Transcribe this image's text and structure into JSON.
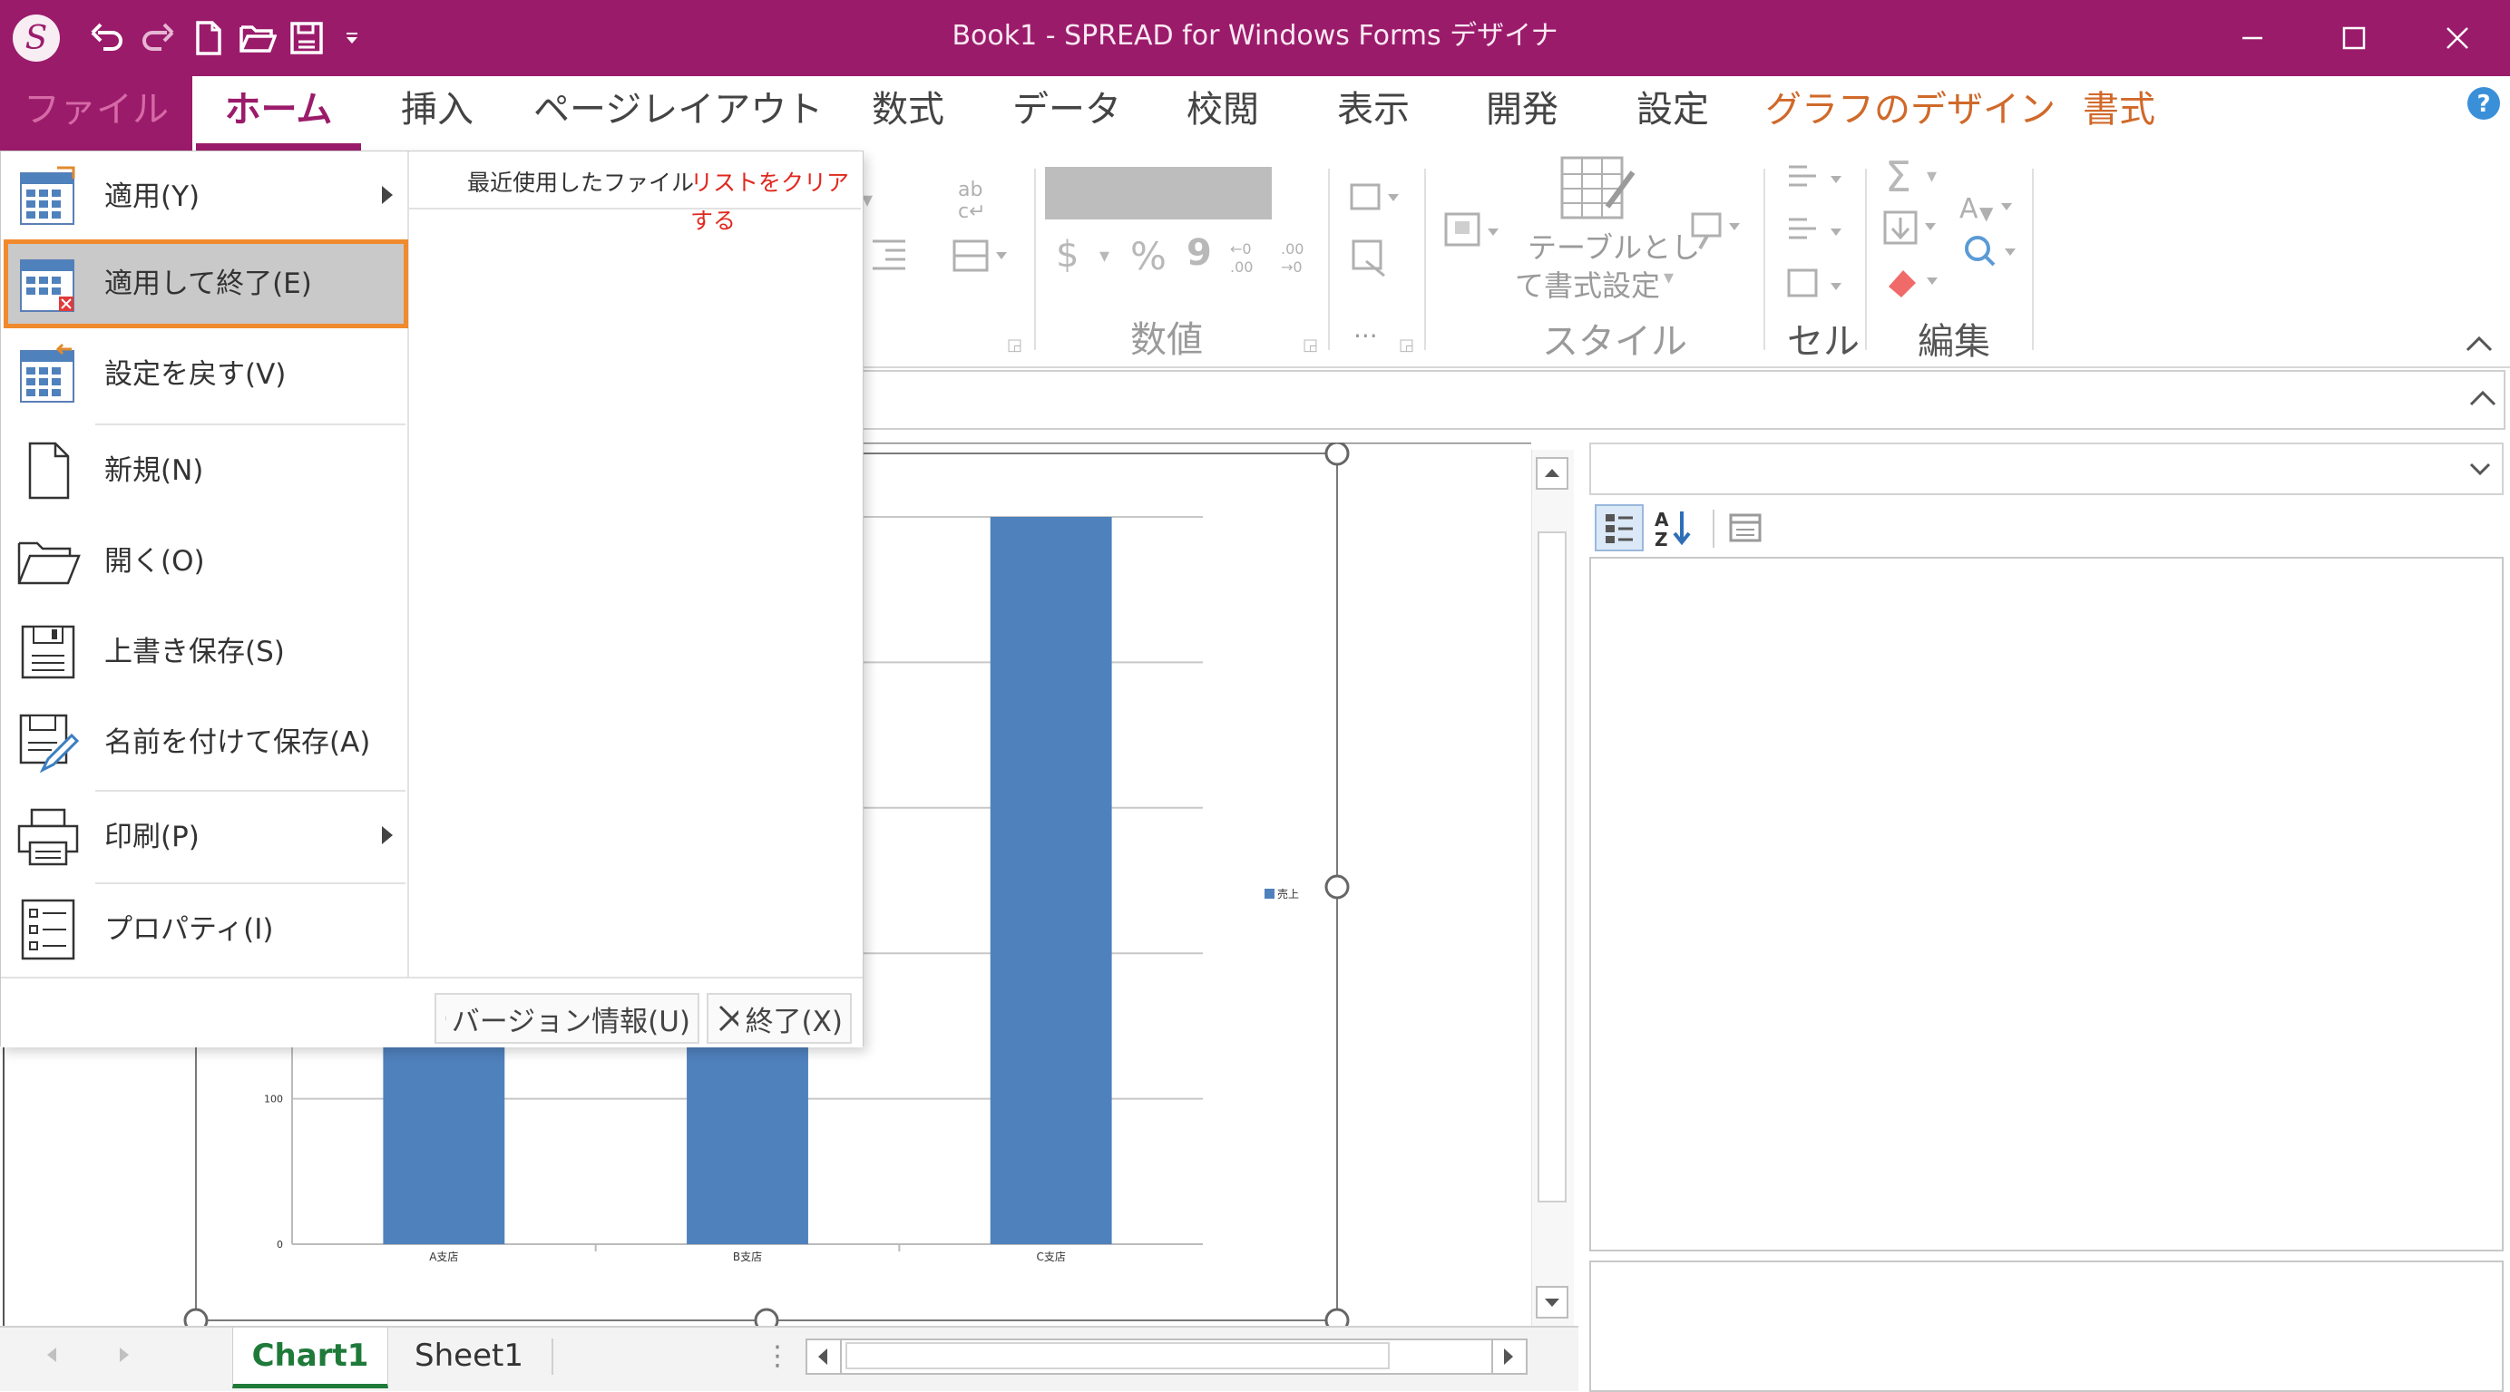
{
  "window": {
    "title": "Book1 - SPREAD for Windows Forms デザイナ",
    "accent_color": "#9b1b6b"
  },
  "quick_access": [
    "app-logo-icon",
    "undo-icon",
    "redo-icon",
    "new-file-icon",
    "open-folder-icon",
    "save-icon",
    "customize-dropdown-icon"
  ],
  "ribbon": {
    "tabs": [
      {
        "label": "ファイル",
        "id": "file"
      },
      {
        "label": "ホーム",
        "id": "home"
      },
      {
        "label": "挿入",
        "id": "insert"
      },
      {
        "label": "ページレイアウト",
        "id": "page-layout"
      },
      {
        "label": "数式",
        "id": "formulas"
      },
      {
        "label": "データ",
        "id": "data"
      },
      {
        "label": "校閲",
        "id": "review"
      },
      {
        "label": "表示",
        "id": "view"
      },
      {
        "label": "開発",
        "id": "developer"
      },
      {
        "label": "設定",
        "id": "settings"
      },
      {
        "label": "グラフのデザイン",
        "id": "chart-design"
      },
      {
        "label": "書式",
        "id": "format"
      }
    ],
    "groups": {
      "number": "数値",
      "style": "スタイル",
      "cells": "セル",
      "editing": "編集",
      "number_currency": "$",
      "number_percent": "%",
      "number_comma": "9",
      "more_dots": "...",
      "format_as_table_line1": "テーブルとし",
      "format_as_table_line2": "て書式設定"
    }
  },
  "file_menu": {
    "items": [
      {
        "label": "適用(Y)",
        "icon": "apply-icon",
        "has_submenu": true
      },
      {
        "label": "適用して終了(E)",
        "icon": "apply-exit-icon",
        "has_submenu": false,
        "highlighted": true
      },
      {
        "label": "設定を戻す(V)",
        "icon": "revert-icon",
        "has_submenu": false
      },
      {
        "label": "新規(N)",
        "icon": "new-file-icon",
        "has_submenu": false
      },
      {
        "label": "開く(O)",
        "icon": "open-folder-icon",
        "has_submenu": false
      },
      {
        "label": "上書き保存(S)",
        "icon": "save-icon",
        "has_submenu": false
      },
      {
        "label": "名前を付けて保存(A)",
        "icon": "save-as-icon",
        "has_submenu": false
      },
      {
        "label": "印刷(P)",
        "icon": "printer-icon",
        "has_submenu": true
      },
      {
        "label": "プロパティ(I)",
        "icon": "properties-icon",
        "has_submenu": false
      }
    ],
    "recent_title": "最近使用したファイル",
    "clear_list": "リストをクリアする",
    "version_info": "バージョン情報(U)",
    "exit": "終了(X)",
    "highlight_color": "#f08a2c"
  },
  "sheet_tabs": [
    {
      "label": "Chart1",
      "active": true
    },
    {
      "label": "Sheet1",
      "active": false
    }
  ],
  "chart_data": {
    "type": "bar",
    "categories": [
      "A支店",
      "B支店",
      "C支店"
    ],
    "values": [
      150,
      150,
      500
    ],
    "legend": {
      "entries": [
        "売上"
      ],
      "placement": "right"
    },
    "ylim": [
      0,
      500
    ],
    "yticks": [
      0,
      100
    ],
    "grid": true,
    "bar_color": "#4f81bd"
  }
}
